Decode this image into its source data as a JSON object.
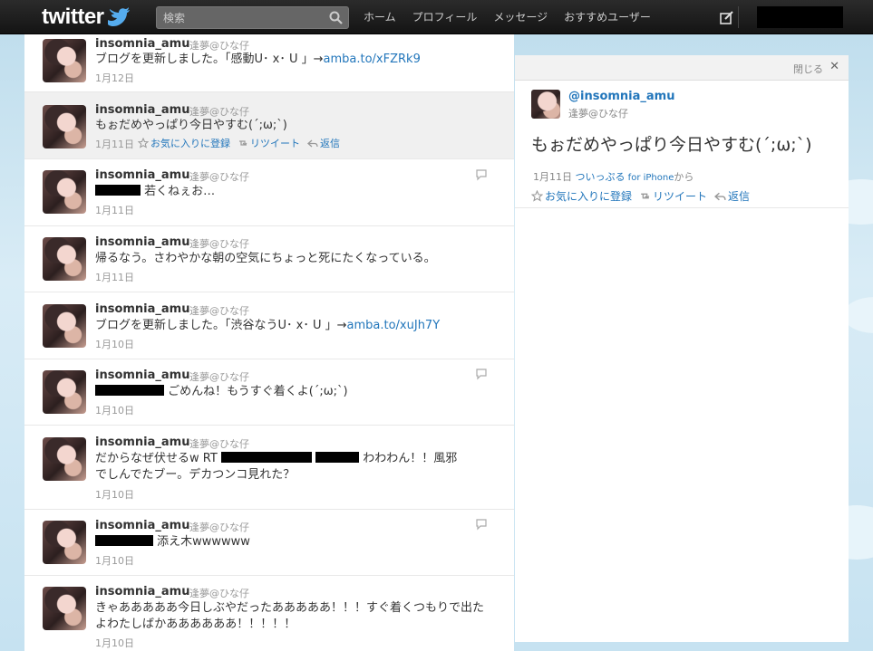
{
  "header": {
    "logo": "twitter",
    "search_placeholder": "検索",
    "nav": [
      "ホーム",
      "プロフィール",
      "メッセージ",
      "おすすめユーザー"
    ]
  },
  "tweets": [
    {
      "user": "insomnia_amu",
      "display": "逢夢@ひな仔",
      "text": "ブログを更新しました。「感動U･ x･ U 」→",
      "link": "amba.to/xFZRk9",
      "date": "1月12日"
    },
    {
      "user": "insomnia_amu",
      "display": "逢夢@ひな仔",
      "text": "もぉだめやっぱり今日やすむ(´;ω;`)",
      "date": "1月11日",
      "actions": [
        "お気に入りに登録",
        "リツイート",
        "返信"
      ]
    },
    {
      "user": "insomnia_amu",
      "display": "逢夢@ひな仔",
      "text_after": " 若くねぇお…",
      "date": "1月11日"
    },
    {
      "user": "insomnia_amu",
      "display": "逢夢@ひな仔",
      "text": "帰るなう。さわやかな朝の空気にちょっと死にたくなっている。",
      "date": "1月11日"
    },
    {
      "user": "insomnia_amu",
      "display": "逢夢@ひな仔",
      "text": "ブログを更新しました。「渋谷なうU･ x･ U 」→",
      "link": "amba.to/xuJh7Y",
      "date": "1月10日"
    },
    {
      "user": "insomnia_amu",
      "display": "逢夢@ひな仔",
      "text_after": " ごめんね！もうすぐ着くよ(´;ω;`)",
      "date": "1月10日"
    },
    {
      "user": "insomnia_amu",
      "display": "逢夢@ひな仔",
      "text_before": "だからなぜ伏せるw RT ",
      "text_mid": " わわわん！！風邪",
      "text_line2": "でしんでたブー。デカつンコ見れた？",
      "date": "1月10日"
    },
    {
      "user": "insomnia_amu",
      "display": "逢夢@ひな仔",
      "text_after": " 添え木wwwwww",
      "date": "1月10日"
    },
    {
      "user": "insomnia_amu",
      "display": "逢夢@ひな仔",
      "text": "きゃあああああ今日しぶやだったあああああ！！！すぐ着くつもりで出た",
      "text_line2": "よわたしばかああああああ！！！！！",
      "date": "1月10日"
    }
  ],
  "details": {
    "close_label": "閉じる",
    "username": "@insomnia_amu",
    "display": "逢夢@ひな仔",
    "text": "もぉだめやっぱり今日やすむ(´;ω;`)",
    "date": "1月11日",
    "via_prefix": "",
    "client": "ついっぷる",
    "client_suffix": " for iPhone",
    "via_suffix": "から",
    "actions": [
      "お気に入りに登録",
      "リツイート",
      "返信"
    ]
  }
}
